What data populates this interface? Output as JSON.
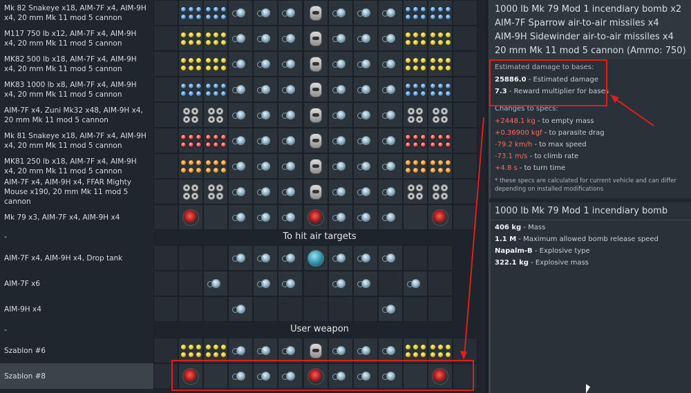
{
  "presets": [
    {
      "label": "Mk 82 Snakeye x18,  AIM-7F x4,  AIM-9H x4,  20 mm Mk 11 mod 5 cannon",
      "slots": [
        "bomb_b",
        "bomb_b",
        "missile",
        "missile",
        "missile",
        "cannon",
        "missile",
        "missile",
        "missile",
        "bomb_b",
        "bomb_b"
      ]
    },
    {
      "label": "M117 750 lb x12,  AIM-7F x4,  AIM-9H x4,  20 mm Mk 11 mod 5 cannon",
      "slots": [
        "bomb_y",
        "bomb_y",
        "missile",
        "missile",
        "missile",
        "cannon",
        "missile",
        "missile",
        "missile",
        "bomb_y",
        "bomb_y"
      ]
    },
    {
      "label": "MK82 500 lb x18,  AIM-7F x4,  AIM-9H x4,  20 mm Mk 11 mod 5 cannon",
      "slots": [
        "bomb_y",
        "bomb_y",
        "missile",
        "missile",
        "missile",
        "cannon",
        "missile",
        "missile",
        "missile",
        "bomb_y",
        "bomb_y"
      ]
    },
    {
      "label": "MK83 1000 lb x8,  AIM-7F x4,  AIM-9H x4,  20 mm Mk 11 mod 5 cannon",
      "slots": [
        "bomb_b",
        "bomb_b",
        "missile",
        "missile",
        "missile",
        "cannon",
        "missile",
        "missile",
        "missile",
        "bomb_b",
        "bomb_b"
      ]
    },
    {
      "label": "AIM-7F x4,  Zuni Mk32 x48,  AIM-9H x4,  20 mm Mk 11 mod 5 cannon",
      "slots": [
        "rocket",
        "rocket",
        "missile",
        "missile",
        "missile",
        "cannon",
        "missile",
        "missile",
        "missile",
        "rocket",
        "rocket"
      ]
    },
    {
      "label": "Mk 81 Snakeye x18,  AIM-7F x4,  AIM-9H x4,  20 mm Mk 11 mod 5 cannon",
      "slots": [
        "bomb_r",
        "bomb_r",
        "missile",
        "missile",
        "missile",
        "cannon",
        "missile",
        "missile",
        "missile",
        "bomb_r",
        "bomb_r"
      ]
    },
    {
      "label": "MK81 250 lb x18,  AIM-7F x4,  AIM-9H x4,  20 mm Mk 11 mod 5 cannon",
      "slots": [
        "bomb_o",
        "bomb_o",
        "missile",
        "missile",
        "missile",
        "cannon",
        "missile",
        "missile",
        "missile",
        "bomb_o",
        "bomb_o"
      ]
    },
    {
      "label": "AIM-7F x4,  AIM-9H x4,  FFAR Mighty Mouse x190,  20 mm Mk 11 mod 5 cannon",
      "slots": [
        "rocket",
        "rocket",
        "missile",
        "missile",
        "missile",
        "cannon",
        "missile",
        "missile",
        "missile",
        "rocket",
        "rocket"
      ]
    },
    {
      "label": "Mk 79 x3,  AIM-7F x4,  AIM-9H x4",
      "slots": [
        "incend",
        "",
        "missile",
        "missile",
        "missile",
        "incend",
        "missile",
        "missile",
        "missile",
        "",
        "incend"
      ]
    }
  ],
  "section_air": "To hit air targets",
  "dash": "-",
  "air_presets": [
    {
      "label": "AIM-7F x4,  AIM-9H x4,  Drop tank",
      "slots": [
        "",
        "",
        "",
        "missile",
        "missile",
        "missile",
        "tank",
        "missile",
        "missile",
        "missile",
        "",
        ""
      ]
    },
    {
      "label": "AIM-7F x6",
      "slots": [
        "",
        "",
        "missile",
        "",
        "missile",
        "missile",
        "",
        "missile",
        "missile",
        "",
        "missile",
        ""
      ]
    },
    {
      "label": "AIM-9H x4",
      "slots": [
        "",
        "",
        "",
        "missile",
        "",
        "",
        "",
        "",
        "",
        "missile",
        "",
        ""
      ]
    }
  ],
  "section_user": "User weapon",
  "user_presets": [
    {
      "label": "Szablon #6"
    },
    {
      "label": "Szablon #8"
    }
  ],
  "detail": {
    "lines": [
      "1000 lb Mk 79 Mod 1 incendiary bomb x2",
      "AIM-7F Sparrow air-to-air missiles x4",
      "AIM-9H Sidewinder air-to-air missiles x4",
      "20 mm Mk 11 mod 5 cannon (Ammo: 750)"
    ],
    "damage_header": "Estimated damage to bases:",
    "damage_value": "25886.0",
    "damage_label": " - Estimated damage",
    "reward_value": "7.3",
    "reward_label": " - Reward multiplier for bases",
    "changes_header": "Changes to specs:",
    "changes": [
      {
        "value": "+2448.1 kg",
        "label": " - to empty mass"
      },
      {
        "value": "+0.36900 kgf",
        "label": " - to parasite drag"
      },
      {
        "value": "-79.2 km/h",
        "label": " - to max speed"
      },
      {
        "value": "-73.1 m/s",
        "label": " - to climb rate"
      },
      {
        "value": "+4.8 s",
        "label": " - to turn time"
      }
    ],
    "note": "* these specs are calculated for current vehicle and can differ depending on installed modifications"
  },
  "bomb": {
    "title": "1000 lb Mk 79 Mod 1 incendiary bomb",
    "specs": [
      {
        "value": "406 kg",
        "label": " - Mass"
      },
      {
        "value": "1.1 M",
        "label": " - Maximum allowed bomb release speed"
      },
      {
        "value": "Napalm-B",
        "label": " - Explosive type"
      },
      {
        "value": "322.1 kg",
        "label": " - Explosive mass"
      }
    ]
  },
  "colors": {
    "annotation": "#e01e1e",
    "negative": "#ff6a5a"
  }
}
